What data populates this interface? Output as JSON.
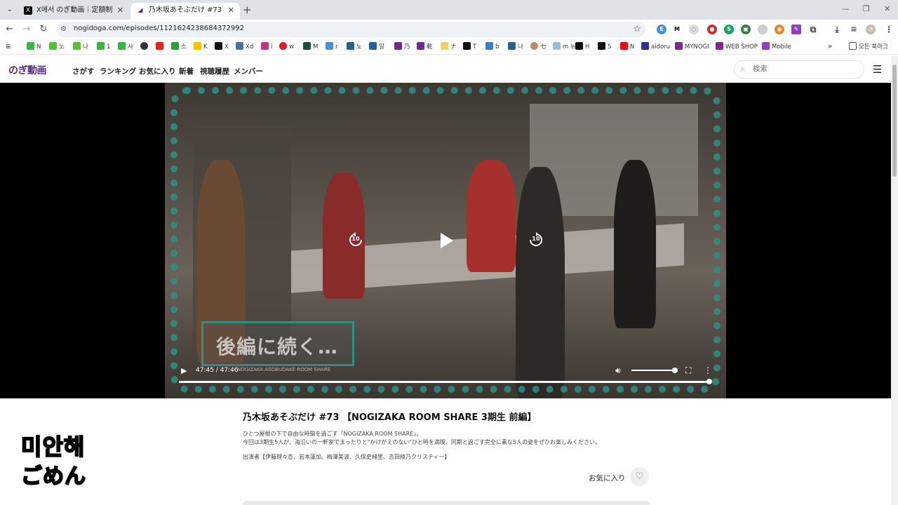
{
  "browser": {
    "tabs": [
      {
        "title": "X에서 のぎ動画｜定額制動画サ",
        "icon": "x-logo-icon"
      },
      {
        "title": "乃木坂あそぶだけ #73【NOGI",
        "icon": "nogidoga-icon"
      }
    ],
    "url": "nogidoga.com/episodes/1121624238684372992",
    "bookmarks": [
      {
        "label": "N"
      },
      {
        "label": "노"
      },
      {
        "label": "나"
      },
      {
        "label": "1"
      },
      {
        "label": "사"
      },
      {
        "label": ""
      },
      {
        "label": ""
      },
      {
        "label": "스"
      },
      {
        "label": "K"
      },
      {
        "label": "X"
      },
      {
        "label": "Xd"
      },
      {
        "label": "i"
      },
      {
        "label": "w"
      },
      {
        "label": "M"
      },
      {
        "label": "r"
      },
      {
        "label": "노"
      },
      {
        "label": "일"
      },
      {
        "label": "乃"
      },
      {
        "label": "乾"
      },
      {
        "label": "ナ"
      },
      {
        "label": "T"
      },
      {
        "label": "b"
      },
      {
        "label": "나"
      },
      {
        "label": "七"
      },
      {
        "label": "m 뉴"
      },
      {
        "label": "H"
      },
      {
        "label": "S"
      },
      {
        "label": "N"
      },
      {
        "label": "aidoru"
      },
      {
        "label": "MYNOGI"
      },
      {
        "label": "WEB SHOP"
      },
      {
        "label": "Mobile"
      }
    ],
    "all_bookmarks": "모든 북마크"
  },
  "site": {
    "logo": "のぎ動画",
    "nav": [
      "さがす",
      "ランキング",
      "お気に入り",
      "新着",
      "視聴履歴",
      "メンバー"
    ],
    "search_placeholder": "検索"
  },
  "player": {
    "overlay_text": "後編に続く…",
    "overlay_sub": "NOGIZAKA ASOBUDAKE ROOM SHARE",
    "rewind_label": "10",
    "forward_label": "10",
    "time": "47:45 / 47:46",
    "progress_fraction": 0.9996,
    "volume_fraction": 1.0
  },
  "episode": {
    "title": "乃木坂あそぶだけ #73 【NOGIZAKA ROOM SHARE 3期生 前編】",
    "description": [
      "ひとつ屋根の下で自由な時間を過ごす「NOGIZAKA ROOM SHARE」。",
      "今回は3期生5人が、海沿いの一軒家でまったりと\"かけがえのない\"ひと時を満喫。同期と過ごす完全に素な5人の姿をぜひお楽しみください。",
      "",
      "出演者【伊藤理々杏、岩本蓮加、梅澤美波、久保史緒里、吉田綾乃クリスティー】"
    ],
    "favorite_label": "お気に入り"
  },
  "sticker": {
    "line1": "미안해",
    "line2": "ごめん"
  },
  "colors": {
    "brand": "#5a2a82",
    "frame_teal": "#2f8f86",
    "player_bg": "#000000"
  }
}
